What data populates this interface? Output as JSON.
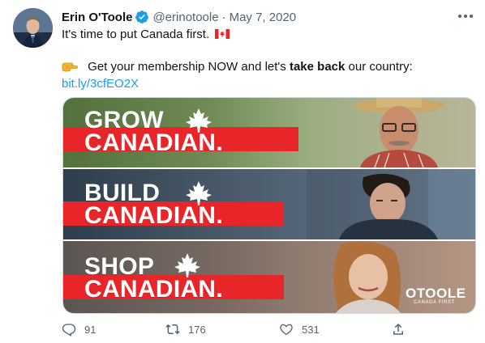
{
  "author": {
    "name": "Erin O'Toole",
    "handle": "@erinotoole",
    "separator": "·",
    "date": "May 7, 2020"
  },
  "text": {
    "line1": "It's time to put Canada first.",
    "line2_pre": "Get your membership NOW and let's",
    "line2_bold": "take back",
    "line2_post": "our country:",
    "link": "bit.ly/3cfEO2X"
  },
  "media": {
    "panels": [
      {
        "word1": "GROW",
        "word2": "CANADIAN."
      },
      {
        "word1": "BUILD",
        "word2": "CANADIAN."
      },
      {
        "word1": "SHOP",
        "word2": "CANADIAN."
      }
    ],
    "logo_main": "OTOOLE",
    "logo_sub": "CANADA FIRST"
  },
  "actions": {
    "replies": "91",
    "retweets": "176",
    "likes": "531"
  },
  "icons": [
    "verified-badge-icon",
    "more-options-icon",
    "canada-flag-icon",
    "pointing-hand-icon",
    "maple-leaf-icon",
    "reply-icon",
    "retweet-icon",
    "like-icon",
    "share-icon"
  ],
  "colors": {
    "link": "#1d9bf0",
    "muted": "#536471",
    "brand_red": "#e8262a",
    "verified": "#1d9bf0"
  }
}
